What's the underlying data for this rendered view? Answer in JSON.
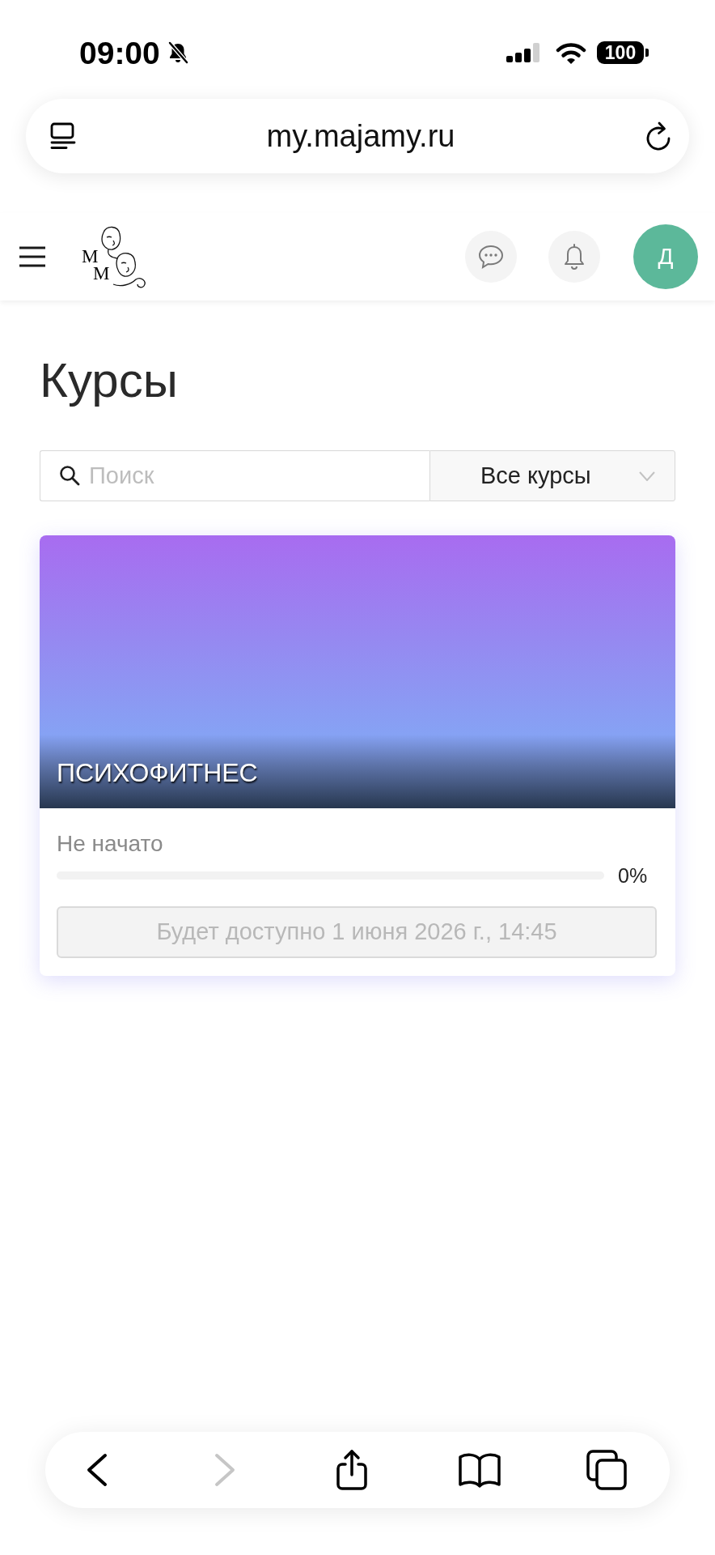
{
  "status_bar": {
    "time": "09:00",
    "battery": "100"
  },
  "browser": {
    "url": "my.majamy.ru"
  },
  "header": {
    "logo": {
      "letters": [
        "M",
        "M"
      ]
    },
    "avatar_initial": "Д"
  },
  "page": {
    "title": "Курсы",
    "search": {
      "placeholder": "Поиск"
    },
    "filter": {
      "value": "Все курсы"
    }
  },
  "courses": [
    {
      "title": "ПСИХОФИТНЕС",
      "status": "Не начато",
      "level": 0,
      "progress_label": "0%",
      "action": {
        "label": "Будет доступно 1 июня 2026 г., 14:45",
        "disabled": true
      }
    }
  ],
  "toolbar": {
    "buttons": [
      {
        "kind": "back",
        "disabled": false
      },
      {
        "kind": "forward",
        "disabled": true
      },
      {
        "kind": "share",
        "disabled": false
      },
      {
        "kind": "bookmarks",
        "disabled": false
      },
      {
        "kind": "tabs",
        "disabled": false
      }
    ]
  }
}
